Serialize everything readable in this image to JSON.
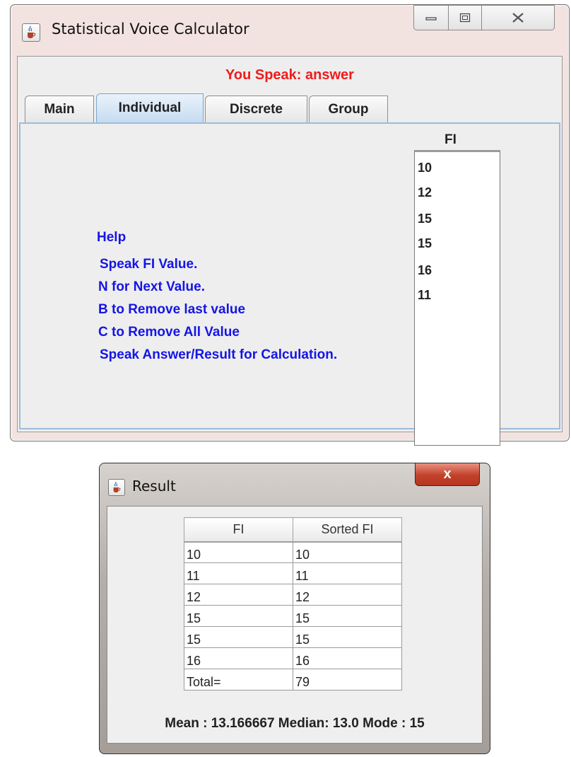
{
  "main_window": {
    "title": "Statistical Voice Calculator",
    "icon": "java-cup-icon",
    "speak_label": "You Speak: answer",
    "tabs": [
      {
        "label": "Main",
        "active": false
      },
      {
        "label": "Individual",
        "active": true
      },
      {
        "label": "Discrete",
        "active": false
      },
      {
        "label": "Group",
        "active": false
      }
    ],
    "help_lines": [
      "Help",
      "Speak FI Value.",
      "N for Next Value.",
      "B to Remove last value",
      "C to Remove All Value",
      "Speak Answer/Result for Calculation."
    ],
    "fi_header": "FI",
    "fi_values": [
      "10",
      "12",
      "15",
      "15",
      "16",
      "11"
    ]
  },
  "result_window": {
    "title": "Result",
    "icon": "java-cup-icon",
    "close_label": "x",
    "table": {
      "columns": [
        "FI",
        "Sorted FI"
      ],
      "rows": [
        [
          "10",
          "10"
        ],
        [
          "11",
          "11"
        ],
        [
          "12",
          "12"
        ],
        [
          "15",
          "15"
        ],
        [
          "15",
          "15"
        ],
        [
          "16",
          "16"
        ],
        [
          "Total=",
          "79"
        ]
      ]
    },
    "stats": "Mean : 13.166667 Median: 13.0 Mode : 15"
  },
  "colors": {
    "speak_label": "#f01b1b",
    "help_text": "#1515e6",
    "active_tab": "#c6dcf1",
    "result_close": "#c2412a"
  }
}
